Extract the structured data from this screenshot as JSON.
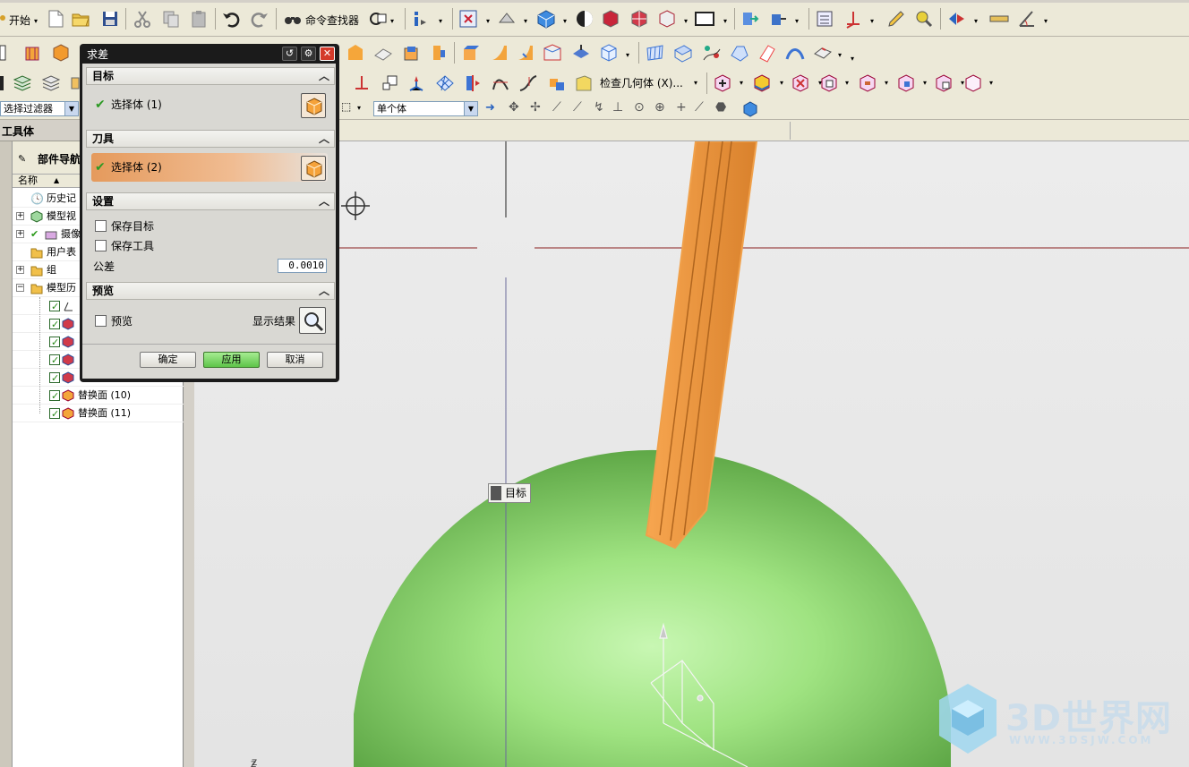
{
  "toolbar": {
    "start_label": "开始",
    "command_finder_label": "命令查找器",
    "check_geometry_label": "检查几何体 (X)...",
    "selection_filter_value": "选择过滤器",
    "selection_scope_value": "单个体"
  },
  "left_panel": {
    "header": "工具体",
    "navigator_title": "部件导航",
    "column_name": "名称",
    "items": [
      {
        "label": "历史记"
      },
      {
        "label": "模型视"
      },
      {
        "label": "摄像"
      },
      {
        "label": "用户表"
      },
      {
        "label": "组"
      },
      {
        "label": "模型历"
      },
      {
        "label": "替换面 (10)"
      },
      {
        "label": "替换面 (11)"
      }
    ]
  },
  "dialog": {
    "title": "求差",
    "target_section": "目标",
    "target_select_label": "选择体 (1)",
    "tool_section": "刀具",
    "tool_select_label": "选择体 (2)",
    "settings_section": "设置",
    "keep_target_label": "保存目标",
    "keep_tool_label": "保存工具",
    "tolerance_label": "公差",
    "tolerance_value": "0.0010",
    "preview_section": "预览",
    "preview_label": "预览",
    "show_result_label": "显示结果",
    "ok_label": "确定",
    "apply_label": "应用",
    "cancel_label": "取消"
  },
  "viewport": {
    "target_tooltip": "目标",
    "axis_label": "Z"
  },
  "watermark": {
    "brand": "3D世界网",
    "url": "WWW.3DSJW.COM"
  },
  "colors": {
    "sphere": "#8fd86a",
    "tool_body": "#f0a04a",
    "apply_button": "#72d65c",
    "dialog_frame": "#1b1b1b"
  }
}
